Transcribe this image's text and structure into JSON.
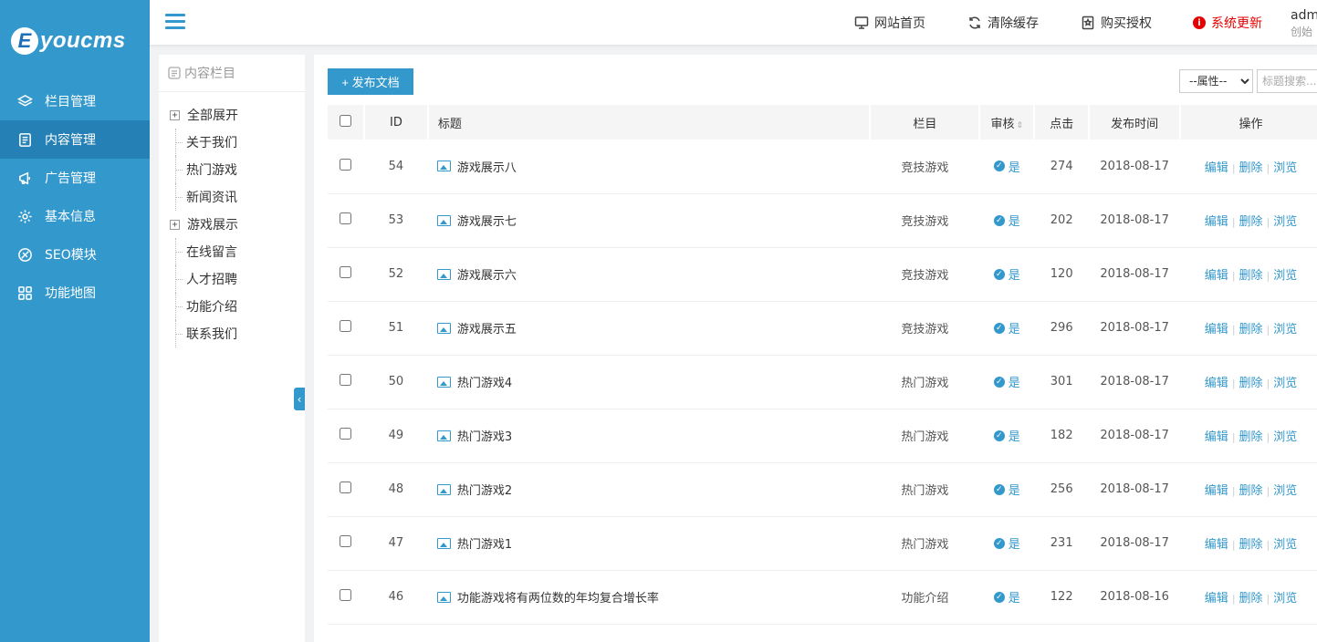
{
  "brand": {
    "mark": "E",
    "name": "youcms"
  },
  "sidebar": {
    "items": [
      {
        "label": "栏目管理",
        "icon": "layers-icon"
      },
      {
        "label": "内容管理",
        "icon": "document-icon",
        "active": true
      },
      {
        "label": "广告管理",
        "icon": "megaphone-icon"
      },
      {
        "label": "基本信息",
        "icon": "gear-icon"
      },
      {
        "label": "SEO模块",
        "icon": "seo-icon"
      },
      {
        "label": "功能地图",
        "icon": "grid-icon"
      }
    ]
  },
  "topbar": {
    "links": [
      {
        "label": "网站首页",
        "icon": "monitor-icon"
      },
      {
        "label": "清除缓存",
        "icon": "refresh-icon"
      },
      {
        "label": "购买授权",
        "icon": "license-icon"
      },
      {
        "label": "系统更新",
        "icon": "info-icon",
        "color": "#e60000"
      }
    ],
    "user": {
      "name": "adm",
      "sub": "创始"
    }
  },
  "tree": {
    "header": "内容栏目",
    "items": [
      {
        "label": "全部展开",
        "toggle": "+"
      },
      {
        "label": "关于我们"
      },
      {
        "label": "热门游戏"
      },
      {
        "label": "新闻资讯"
      },
      {
        "label": "游戏展示",
        "toggle": "+"
      },
      {
        "label": "在线留言"
      },
      {
        "label": "人才招聘"
      },
      {
        "label": "功能介绍"
      },
      {
        "label": "联系我们"
      }
    ]
  },
  "toolbar": {
    "publish_label": "+ 发布文档",
    "attr_selected": "--属性--",
    "search_placeholder": "标题搜索..."
  },
  "table": {
    "headers": {
      "id": "ID",
      "title": "标题",
      "column": "栏目",
      "audit": "审核",
      "hits": "点击",
      "date": "发布时间",
      "ops": "操作"
    },
    "ops": {
      "edit": "编辑",
      "delete": "删除",
      "view": "浏览"
    },
    "rows": [
      {
        "id": "54",
        "title": "游戏展示八",
        "column": "竞技游戏",
        "audit": "是",
        "hits": "274",
        "date": "2018-08-17"
      },
      {
        "id": "53",
        "title": "游戏展示七",
        "column": "竞技游戏",
        "audit": "是",
        "hits": "202",
        "date": "2018-08-17"
      },
      {
        "id": "52",
        "title": "游戏展示六",
        "column": "竞技游戏",
        "audit": "是",
        "hits": "120",
        "date": "2018-08-17"
      },
      {
        "id": "51",
        "title": "游戏展示五",
        "column": "竞技游戏",
        "audit": "是",
        "hits": "296",
        "date": "2018-08-17"
      },
      {
        "id": "50",
        "title": "热门游戏4",
        "column": "热门游戏",
        "audit": "是",
        "hits": "301",
        "date": "2018-08-17"
      },
      {
        "id": "49",
        "title": "热门游戏3",
        "column": "热门游戏",
        "audit": "是",
        "hits": "182",
        "date": "2018-08-17"
      },
      {
        "id": "48",
        "title": "热门游戏2",
        "column": "热门游戏",
        "audit": "是",
        "hits": "256",
        "date": "2018-08-17"
      },
      {
        "id": "47",
        "title": "热门游戏1",
        "column": "热门游戏",
        "audit": "是",
        "hits": "231",
        "date": "2018-08-17"
      },
      {
        "id": "46",
        "title": "功能游戏将有两位数的年均复合增长率",
        "column": "功能介绍",
        "audit": "是",
        "hits": "122",
        "date": "2018-08-16"
      }
    ]
  },
  "colors": {
    "primary": "#3398cc",
    "primary_dark": "#2580b5",
    "warn": "#e60000"
  }
}
